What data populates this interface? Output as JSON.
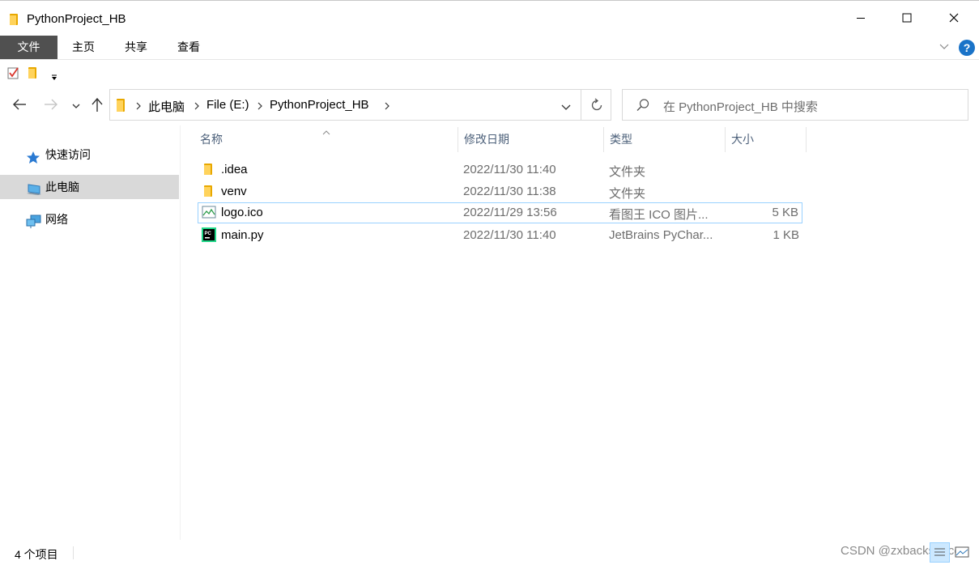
{
  "window": {
    "title": "PythonProject_HB"
  },
  "ribbon": {
    "tabs": [
      {
        "label": "文件"
      },
      {
        "label": "主页"
      },
      {
        "label": "共享"
      },
      {
        "label": "查看"
      }
    ]
  },
  "help_label": "?",
  "address": {
    "crumbs": [
      "此电脑",
      "File (E:)",
      "PythonProject_HB"
    ]
  },
  "search": {
    "placeholder": "在 PythonProject_HB 中搜索"
  },
  "nav_pane": {
    "items": [
      {
        "label": "快速访问",
        "icon": "star-icon"
      },
      {
        "label": "此电脑",
        "icon": "computer-icon",
        "selected": true
      },
      {
        "label": "网络",
        "icon": "network-icon"
      }
    ]
  },
  "file_list": {
    "columns": [
      "名称",
      "修改日期",
      "类型",
      "大小"
    ],
    "sorted_by": "名称",
    "rows": [
      {
        "name": ".idea",
        "date": "2022/11/30 11:40",
        "type": "文件夹",
        "size": "",
        "icon": "folder-icon"
      },
      {
        "name": "venv",
        "date": "2022/11/30 11:38",
        "type": "文件夹",
        "size": "",
        "icon": "folder-icon"
      },
      {
        "name": "logo.ico",
        "date": "2022/11/29 13:56",
        "type": "看图王 ICO 图片...",
        "size": "5 KB",
        "icon": "image-file-icon",
        "selected": true
      },
      {
        "name": "main.py",
        "date": "2022/11/30 11:40",
        "type": "JetBrains PyChar...",
        "size": "1 KB",
        "icon": "pycharm-file-icon"
      }
    ]
  },
  "pycharm_badge": "PC",
  "status": {
    "count": "4 个项目",
    "watermark": "CSDN @zxbackspace"
  },
  "colors": {
    "file_tab_bg": "#505050",
    "selection_border": "#99d1ff",
    "nav_selected_bg": "#d9d9d9",
    "column_header_text": "#4c607a",
    "help_blue": "#1a73c8",
    "folder_yellow": "#ffc83d"
  }
}
